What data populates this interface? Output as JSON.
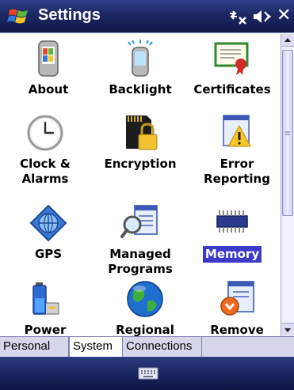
{
  "title_bar": {
    "title": "Settings",
    "icons": [
      "start-flag-icon",
      "connectivity-icon",
      "volume-muted-icon",
      "close-icon"
    ],
    "close_glyph": "✕"
  },
  "items": [
    {
      "label": "About",
      "icon": "about-phone-icon"
    },
    {
      "label": "Backlight",
      "icon": "backlight-phone-icon"
    },
    {
      "label": "Certificates",
      "icon": "certificate-icon"
    },
    {
      "label": "Clock & Alarms",
      "icon": "clock-icon"
    },
    {
      "label": "Encryption",
      "icon": "encryption-lock-icon"
    },
    {
      "label": "Error Reporting",
      "icon": "error-reporting-icon"
    },
    {
      "label": "GPS",
      "icon": "gps-globe-icon"
    },
    {
      "label": "Managed Programs",
      "icon": "managed-programs-icon"
    },
    {
      "label": "Memory",
      "icon": "memory-chip-icon",
      "selected": true
    },
    {
      "label": "Power",
      "icon": "power-battery-icon"
    },
    {
      "label": "Regional",
      "icon": "regional-globe-icon"
    },
    {
      "label": "Remove",
      "icon": "remove-programs-icon"
    }
  ],
  "tabs": [
    "Personal",
    "System",
    "Connections"
  ],
  "active_tab": "System",
  "bottom_bar": {
    "icon": "keyboard-icon"
  },
  "colors": {
    "title_bar": "#1c2864",
    "selection": "#3a3bc8",
    "tab_bar": "#d7d7eb"
  }
}
